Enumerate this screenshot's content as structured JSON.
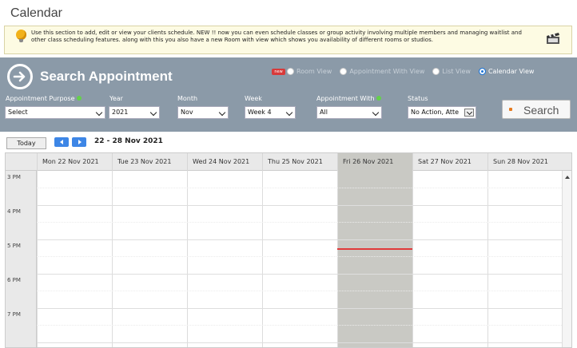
{
  "page": {
    "title": "Calendar"
  },
  "info": {
    "text": "Use this section to add, edit or view your clients schedule. NEW !! now you can even schedule classes or group activity involving multiple members and managing waitlist and other class scheduling features. along with this you also have a new Room with view which shows you availability of different rooms or studios."
  },
  "search_panel": {
    "title": "Search Appointment",
    "new_badge": "new",
    "views": [
      {
        "label": "Room View",
        "selected": false
      },
      {
        "label": "Appointment With View",
        "selected": false
      },
      {
        "label": "List View",
        "selected": false
      },
      {
        "label": "Calendar View",
        "selected": true
      }
    ],
    "fields": {
      "purpose": {
        "label": "Appointment Purpose",
        "value": "Select"
      },
      "year": {
        "label": "Year",
        "value": "2021"
      },
      "month": {
        "label": "Month",
        "value": "Nov"
      },
      "week": {
        "label": "Week",
        "value": "Week 4"
      },
      "with": {
        "label": "Appointment With",
        "value": "All"
      },
      "status": {
        "label": "Status",
        "value": "No Action, Atte"
      }
    },
    "search_label": "Search"
  },
  "toolbar": {
    "today_label": "Today",
    "range": "22 - 28 Nov 2021"
  },
  "calendar": {
    "days": [
      "Mon 22 Nov 2021",
      "Tue 23 Nov 2021",
      "Wed 24 Nov 2021",
      "Thu 25 Nov 2021",
      "Fri 26 Nov 2021",
      "Sat 27 Nov 2021",
      "Sun 28 Nov 2021"
    ],
    "today_index": 4,
    "hours": [
      "3 PM",
      "4 PM",
      "5 PM",
      "6 PM",
      "7 PM"
    ]
  },
  "colors": {
    "accent": "#1b74d8",
    "panel": "#8b9aa8",
    "today_column": "#c9c9c4",
    "now_line": "#e03a3a",
    "required_dot": "#64d04a"
  }
}
